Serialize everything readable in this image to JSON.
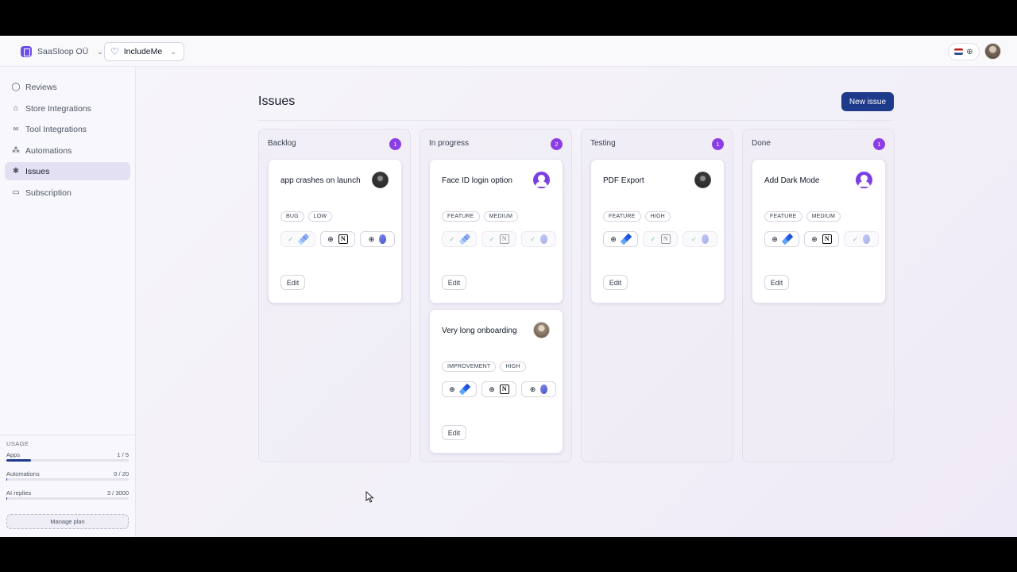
{
  "header": {
    "org_name": "SaaSloop OÜ",
    "app_name": "IncludeMe"
  },
  "sidebar": {
    "items": [
      {
        "label": "Reviews",
        "icon": "chat-bubble-icon"
      },
      {
        "label": "Store Integrations",
        "icon": "store-icon"
      },
      {
        "label": "Tool Integrations",
        "icon": "link-icon"
      },
      {
        "label": "Automations",
        "icon": "workflow-icon"
      },
      {
        "label": "Issues",
        "icon": "bug-icon",
        "active": true
      },
      {
        "label": "Subscription",
        "icon": "card-icon"
      }
    ],
    "usage": {
      "title": "USAGE",
      "apps_label": "Apps",
      "apps_value": "1 / 5",
      "apps_fraction": 0.2,
      "automations_label": "Automations",
      "automations_value": "0 / 20",
      "automations_fraction": 0,
      "ai_label": "AI replies",
      "ai_value": "3 / 3000",
      "ai_fraction": 0.001,
      "manage_label": "Manage plan"
    }
  },
  "main": {
    "title": "Issues",
    "new_issue_label": "New issue",
    "columns": [
      {
        "title": "Backlog",
        "count": "1",
        "cards": [
          {
            "title": "app crashes on launch",
            "tags": [
              "BUG",
              "LOW"
            ],
            "edit": "Edit"
          }
        ]
      },
      {
        "title": "In progress",
        "count": "2",
        "cards": [
          {
            "title": "Face ID login option",
            "tags": [
              "FEATURE",
              "MEDIUM"
            ],
            "edit": "Edit"
          },
          {
            "title": "Very long onboarding",
            "tags": [
              "IMPROVEMENT",
              "HIGH"
            ],
            "edit": "Edit"
          }
        ]
      },
      {
        "title": "Testing",
        "count": "1",
        "cards": [
          {
            "title": "PDF Export",
            "tags": [
              "FEATURE",
              "HIGH"
            ],
            "edit": "Edit"
          }
        ]
      },
      {
        "title": "Done",
        "count": "1",
        "cards": [
          {
            "title": "Add Dark Mode",
            "tags": [
              "FEATURE",
              "MEDIUM"
            ],
            "edit": "Edit"
          }
        ]
      }
    ]
  },
  "colors": {
    "accent": "#1e3a8a",
    "badge": "#8b3ee6",
    "active_nav": "#e4e0f3",
    "synced": "#8ecf9f"
  },
  "icons": {
    "add": "⊕",
    "synced": "✓",
    "notion": "N"
  }
}
